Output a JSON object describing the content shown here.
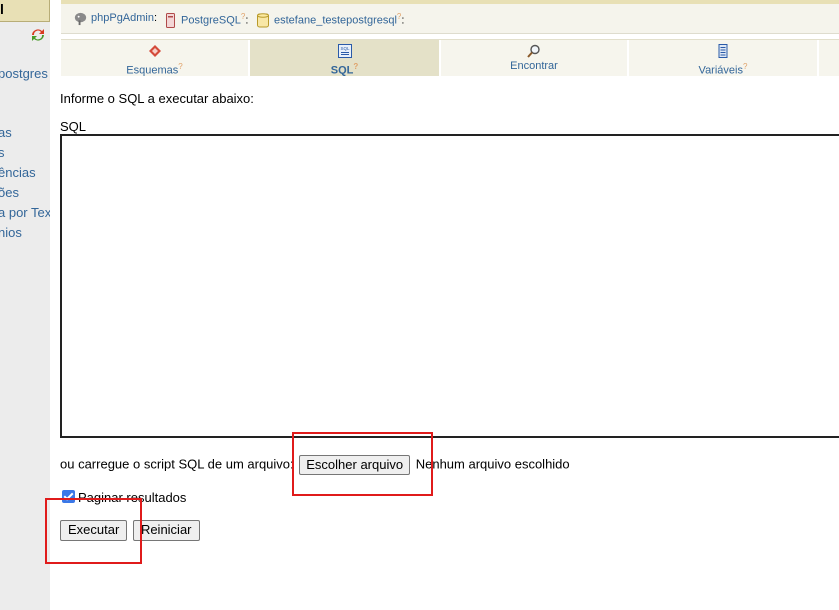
{
  "sidebar": {
    "top_label": "l",
    "items": [
      "postgres",
      "as",
      "s",
      "ências",
      "ões",
      "a por Tex",
      "nios"
    ]
  },
  "breadcrumb": {
    "app": "phpPgAdmin",
    "server": "PostgreSQL",
    "database": "estefane_testepostgresql",
    "help_mark": "?"
  },
  "tabs": [
    {
      "label": "Esquemas",
      "icon": "schemas-icon",
      "active": false,
      "help": "?"
    },
    {
      "label": "SQL",
      "icon": "sql-icon",
      "active": true,
      "help": "?"
    },
    {
      "label": "Encontrar",
      "icon": "find-icon",
      "active": false,
      "help": ""
    },
    {
      "label": "Variáveis",
      "icon": "variables-icon",
      "active": false,
      "help": "?"
    }
  ],
  "main": {
    "intro": "Informe o SQL a executar abaixo:",
    "sql_label": "SQL",
    "sql_value": "",
    "upload_label": "ou carregue o script SQL de um arquivo:",
    "choose_file_button": "Escolher arquivo",
    "no_file_text": "Nenhum arquivo escolhido",
    "paginate_label": "Paginar resultados",
    "paginate_checked": true,
    "execute_button": "Executar",
    "reset_button": "Reiniciar"
  },
  "colors": {
    "link": "#336699",
    "annotation": "#e01b1b",
    "tab_active": "#e4e1c8",
    "header_accent": "#e8e0b5"
  }
}
